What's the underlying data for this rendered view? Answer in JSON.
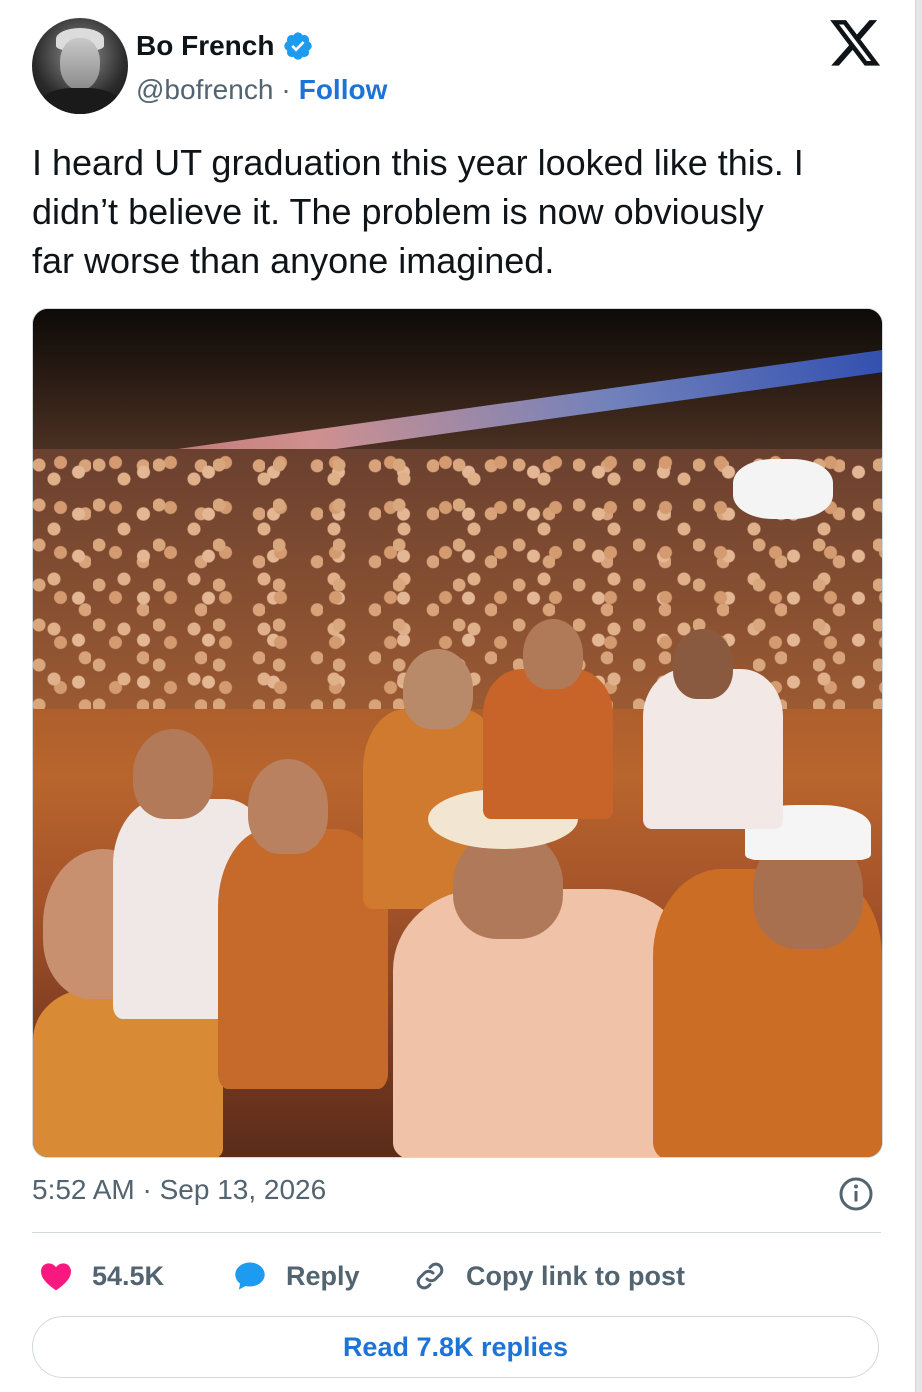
{
  "author": {
    "display_name": "Bo French",
    "handle": "@bofrench",
    "separator": "·",
    "follow_label": "Follow",
    "verified": true
  },
  "tweet": {
    "text": "I heard UT graduation this year looked like this. I\ndidn’t believe it. The problem is now obviously\nfar worse than anyone imagined.",
    "timestamp": "5:52 AM · Sep 13, 2026",
    "image_description_icon": "info-icon"
  },
  "actions": {
    "like_count": "54.5K",
    "reply_label": "Reply",
    "copy_link_label": "Copy link to post",
    "read_replies_label": "Read 7.8K replies"
  },
  "colors": {
    "brand_blue": "#1d74d7",
    "like_red": "#f91880",
    "reply_blue": "#1d9bf0",
    "secondary_text": "#536471",
    "border": "#cfd9de"
  },
  "icons": {
    "brand": "x-logo-icon",
    "verified": "verified-badge-icon",
    "like": "heart-icon",
    "reply": "speech-bubble-icon",
    "copy": "link-icon",
    "info": "info-icon"
  }
}
